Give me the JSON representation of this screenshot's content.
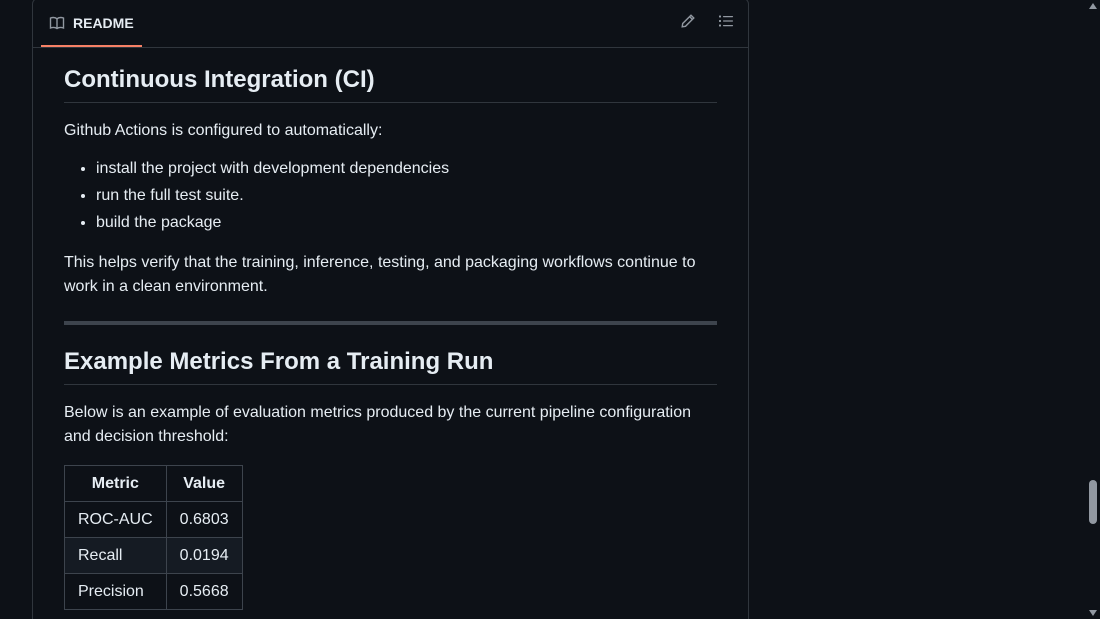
{
  "readme_tab": {
    "label": "README"
  },
  "icons": {
    "book": "book-icon",
    "edit": "pencil-icon",
    "outline": "list-icon"
  },
  "sections": {
    "ci": {
      "heading": "Continuous Integration (CI)",
      "intro": "Github Actions is configured to automatically:",
      "items": [
        "install the project with development dependencies",
        "run the full test suite.",
        "build the package"
      ],
      "outro": "This helps verify that the training, inference, testing, and packaging workflows continue to work in a clean environment."
    },
    "metrics": {
      "heading": "Example Metrics From a Training Run",
      "intro": "Below is an example of evaluation metrics produced by the current pipeline configuration and decision threshold:",
      "table": {
        "headers": [
          "Metric",
          "Value"
        ],
        "rows": [
          [
            "ROC-AUC",
            "0.6803"
          ],
          [
            "Recall",
            "0.0194"
          ],
          [
            "Precision",
            "0.5668"
          ]
        ]
      }
    }
  },
  "colors": {
    "tab_underline": "#f78166",
    "background": "#0d1117",
    "border": "#30363d"
  }
}
